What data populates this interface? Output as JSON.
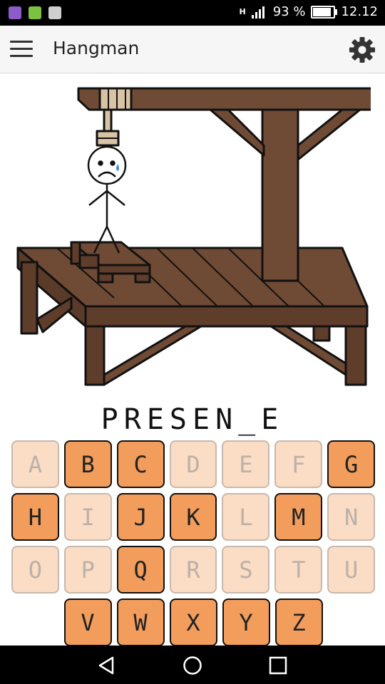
{
  "status": {
    "battery": "93 %",
    "time": "12.12",
    "network": "H"
  },
  "app": {
    "title": "Hangman"
  },
  "game": {
    "word_display": "PRESEN_E",
    "keyboard": [
      [
        {
          "letter": "A",
          "used": true
        },
        {
          "letter": "B",
          "used": false
        },
        {
          "letter": "C",
          "used": false
        },
        {
          "letter": "D",
          "used": true
        },
        {
          "letter": "E",
          "used": true
        },
        {
          "letter": "F",
          "used": true
        },
        {
          "letter": "G",
          "used": false
        }
      ],
      [
        {
          "letter": "H",
          "used": false
        },
        {
          "letter": "I",
          "used": true
        },
        {
          "letter": "J",
          "used": false
        },
        {
          "letter": "K",
          "used": false
        },
        {
          "letter": "L",
          "used": true
        },
        {
          "letter": "M",
          "used": false
        },
        {
          "letter": "N",
          "used": true
        }
      ],
      [
        {
          "letter": "O",
          "used": true
        },
        {
          "letter": "P",
          "used": true
        },
        {
          "letter": "Q",
          "used": false
        },
        {
          "letter": "R",
          "used": true
        },
        {
          "letter": "S",
          "used": true
        },
        {
          "letter": "T",
          "used": true
        },
        {
          "letter": "U",
          "used": true
        }
      ],
      [
        {
          "letter": "V",
          "used": false
        },
        {
          "letter": "W",
          "used": false
        },
        {
          "letter": "X",
          "used": false
        },
        {
          "letter": "Y",
          "used": false
        },
        {
          "letter": "Z",
          "used": false
        }
      ]
    ]
  },
  "colors": {
    "wood": "#6f4a35",
    "key_active": "#f29d5c",
    "key_used": "#fbdcc4",
    "rope": "#d9c3a5"
  }
}
